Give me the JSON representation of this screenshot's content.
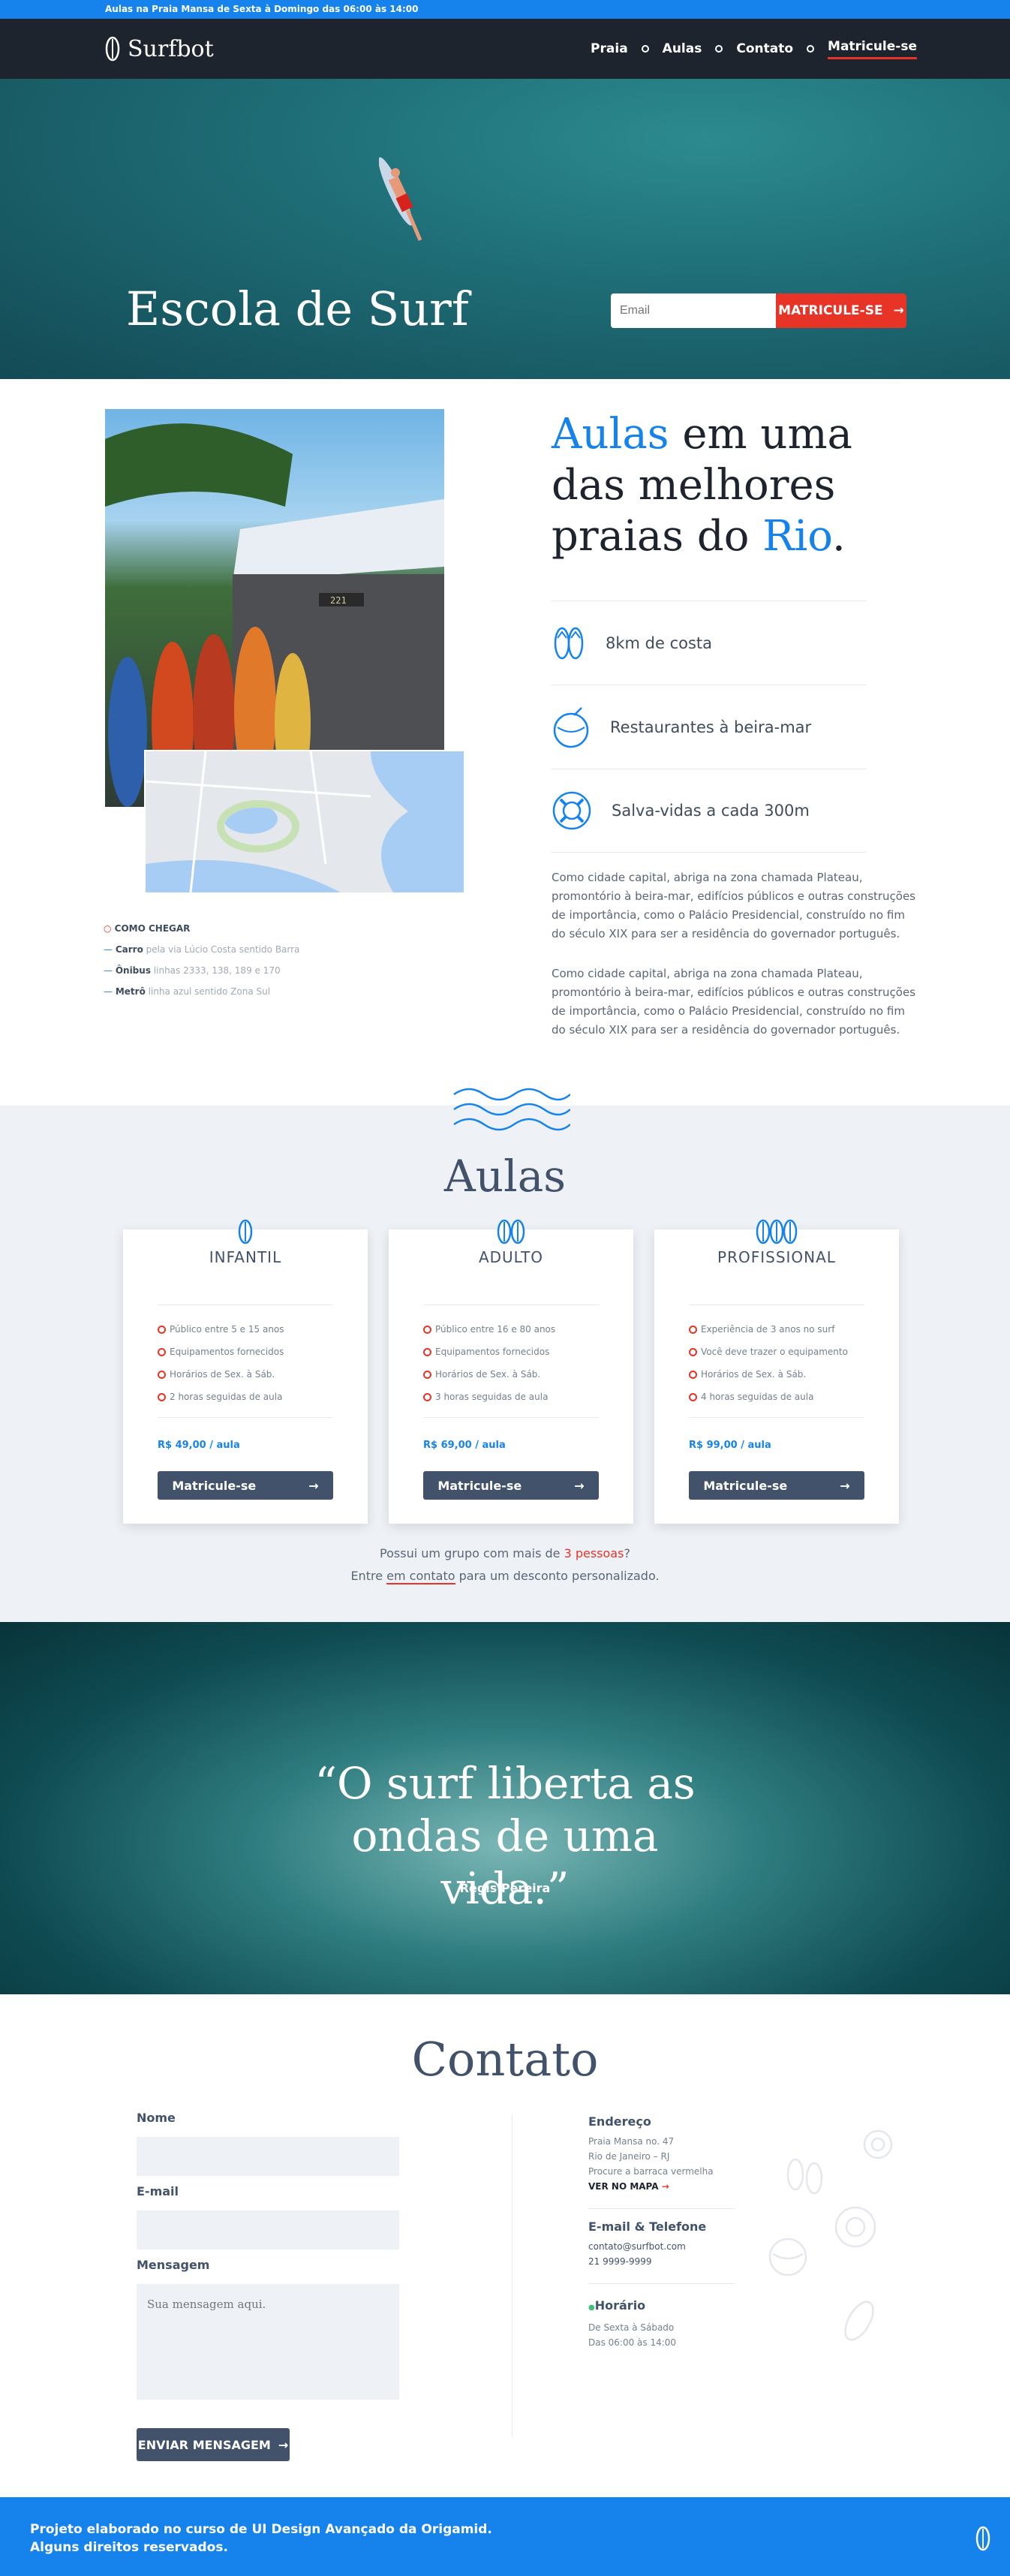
{
  "topbar": {
    "text": "Aulas na Praia Mansa de Sexta à Domingo das 06:00 às 14:00"
  },
  "nav": {
    "brand": "Surfbot",
    "items": [
      {
        "label": "Praia"
      },
      {
        "label": "Aulas"
      },
      {
        "label": "Contato"
      },
      {
        "label": "Matricule-se"
      }
    ]
  },
  "hero": {
    "title": "Escola de Surf",
    "email_placeholder": "Email",
    "cta": "MATRICULE-SE"
  },
  "about": {
    "heading_a": "Aulas",
    "heading_b": " em uma das melhores praias do ",
    "heading_c": "Rio",
    "heading_d": ".",
    "features": [
      "8km de costa",
      "Restaurantes à beira-mar",
      "Salva-vidas a cada 300m"
    ],
    "paragraph_1": "Como cidade capital, abriga na zona chamada Plateau, promontório à beira-mar, edifícios públicos e outras construções de importância, como o Palácio Presidencial, construído no fim do século XIX para ser a residência do governador português.",
    "paragraph_2": "Como cidade capital, abriga na zona chamada Plateau, promontório à beira-mar, edifícios públicos e outras construções de importância, como o Palácio Presidencial, construído no fim do século XIX para ser a residência do governador português.",
    "photo_sign": "221",
    "directions_title": "COMO CHEGAR",
    "directions": [
      {
        "mode": "Carro",
        "detail": "pela via Lúcio Costa sentido Barra"
      },
      {
        "mode": "Ônibus",
        "detail": "linhas 2333, 138, 189 e 170"
      },
      {
        "mode": "Metrô",
        "detail": "linha azul sentido Zona Sul"
      }
    ]
  },
  "classes": {
    "title": "Aulas",
    "cards": [
      {
        "name": "INFANTIL",
        "items": [
          "Público entre 5 e 15 anos",
          "Equipamentos fornecidos",
          "Horários de Sex. à Sáb.",
          "2 horas seguidas de aula"
        ],
        "price": "R$ 49,00 / aula",
        "button": "Matricule-se"
      },
      {
        "name": "ADULTO",
        "items": [
          "Público entre 16 e 80 anos",
          "Equipamentos fornecidos",
          "Horários de Sex. à Sáb.",
          "3 horas seguidas de aula"
        ],
        "price": "R$ 69,00 / aula",
        "button": "Matricule-se"
      },
      {
        "name": "PROFISSIONAL",
        "items": [
          "Experiência de 3 anos no surf",
          "Você deve trazer o equipamento",
          "Horários de Sex. à Sáb.",
          "4 horas seguidas de aula"
        ],
        "price": "R$ 99,00 / aula",
        "button": "Matricule-se"
      }
    ],
    "group_a": "Possui um grupo com mais de ",
    "group_b": "3 pessoas",
    "group_c": "?",
    "group_d": "Entre ",
    "group_e": "em contato",
    "group_f": " para um desconto personalizado."
  },
  "quote": {
    "text": "“O surf liberta as ondas de uma vida.”",
    "author": "Regis Pereira"
  },
  "contact": {
    "title": "Contato",
    "name_label": "Nome",
    "email_label": "E-mail",
    "message_label": "Mensagem",
    "message_placeholder": "Sua mensagem aqui.",
    "send": "ENVIAR MENSAGEM",
    "address_title": "Endereço",
    "address_lines": [
      "Praia Mansa no. 47",
      "Rio de Janeiro – RJ",
      "Procure a barraca vermelha"
    ],
    "map_link": "VER NO MAPA",
    "phone_title": "E-mail & Telefone",
    "email": "contato@surfbot.com",
    "phone": "21 9999-9999",
    "hours_title": "Horário",
    "hours_lines": [
      "De Sexta à Sábado",
      "Das 06:00 às 14:00"
    ]
  },
  "footer": {
    "line1": "Projeto elaborado no curso de UI Design Avançado da Origamid.",
    "line2": "Alguns direitos reservados."
  },
  "colors": {
    "accent": "#1683ed",
    "cta": "#e83327",
    "dark": "#1e242e",
    "slate": "#42526b"
  }
}
